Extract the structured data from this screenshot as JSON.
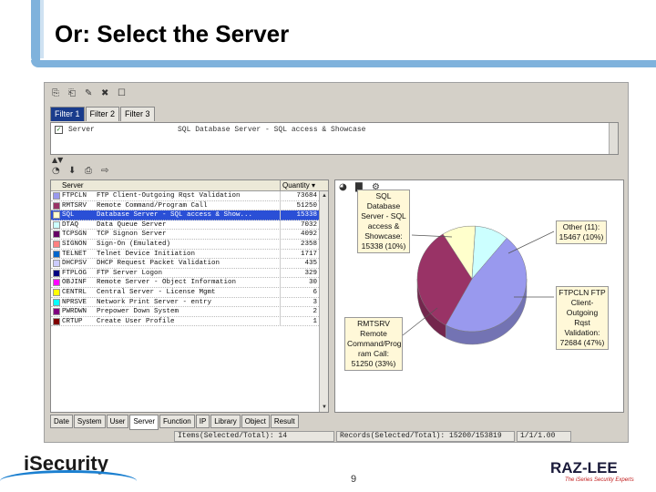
{
  "slide": {
    "title": "Or: Select the Server",
    "page_number": "9"
  },
  "logos": {
    "left": "iSecurity",
    "right": "RAZ-LEE",
    "right_tagline": "The iSeries Security Experts"
  },
  "top_tabs": [
    "Filter 1",
    "Filter 2",
    "Filter 3"
  ],
  "filter": {
    "field": "Server",
    "value": "SQL   Database Server - SQL access & Showcase",
    "checked": true
  },
  "grid": {
    "headers": {
      "server": "Server",
      "quantity": "Quantity"
    },
    "rows": [
      {
        "code": "FTPCLN",
        "desc": "FTP Client-Outgoing Rqst Validation",
        "qty": "73684",
        "color": "#9999ee",
        "selected": false
      },
      {
        "code": "RMTSRV",
        "desc": "Remote Command/Program Call",
        "qty": "51250",
        "color": "#993366",
        "selected": false
      },
      {
        "code": "SQL",
        "desc": "Database Server - SQL access & Show...",
        "qty": "15338",
        "color": "#ffffcc",
        "selected": true
      },
      {
        "code": "DTAQ",
        "desc": "Data Queue Server",
        "qty": "7032",
        "color": "#ccffff",
        "selected": false
      },
      {
        "code": "TCPSGN",
        "desc": "TCP Signon Server",
        "qty": "4092",
        "color": "#660066",
        "selected": false
      },
      {
        "code": "SIGNON",
        "desc": "Sign-On (Emulated)",
        "qty": "2358",
        "color": "#ff8080",
        "selected": false
      },
      {
        "code": "TELNET",
        "desc": "Telnet Device Initiation",
        "qty": "1717",
        "color": "#0066cc",
        "selected": false
      },
      {
        "code": "DHCPSV",
        "desc": "DHCP Request Packet Validation",
        "qty": "435",
        "color": "#ccccff",
        "selected": false
      },
      {
        "code": "FTPLOG",
        "desc": "FTP Server Logon",
        "qty": "329",
        "color": "#000080",
        "selected": false
      },
      {
        "code": "OBJINF",
        "desc": "Remote Server - Object Information",
        "qty": "30",
        "color": "#ff00ff",
        "selected": false
      },
      {
        "code": "CENTRL",
        "desc": "Central Server - License Mgmt",
        "qty": "6",
        "color": "#ffff00",
        "selected": false
      },
      {
        "code": "NPRSVE",
        "desc": "Network Print Server - entry",
        "qty": "3",
        "color": "#00ffff",
        "selected": false
      },
      {
        "code": "PWRDWN",
        "desc": "Prepower Down System",
        "qty": "2",
        "color": "#800080",
        "selected": false
      },
      {
        "code": "CRTUP",
        "desc": "Create User Profile",
        "qty": "1",
        "color": "#800000",
        "selected": false
      }
    ]
  },
  "chart_data": {
    "type": "pie",
    "title": "",
    "slices": [
      {
        "label": "FTPCLN FTP Client-Outgoing Rqst Validation",
        "value": 72684,
        "percent": 47,
        "color": "#9999ee"
      },
      {
        "label": "RMTSRV Remote Command/Program Call",
        "value": 51250,
        "percent": 33,
        "color": "#993366"
      },
      {
        "label": "SQL Database Server - SQL access & Showcase",
        "value": 15338,
        "percent": 10,
        "color": "#ffffcc"
      },
      {
        "label": "Other (11)",
        "value": 15467,
        "percent": 10,
        "color": "#ccffff"
      }
    ],
    "callouts": {
      "sql": [
        "SQL",
        "Database",
        "Server - SQL",
        "access &",
        "Showcase:",
        "15338 (10%)"
      ],
      "other": [
        "Other (11):",
        "15467 (10%)"
      ],
      "ftpcln": [
        "FTPCLN FTP",
        "Client-",
        "Outgoing Rqst",
        "Validation:",
        "72684 (47%)"
      ],
      "rmtsrv": [
        "RMTSRV",
        "Remote",
        "Command/Prog",
        "ram Call:",
        "51250 (33%)"
      ]
    }
  },
  "bottom_tabs": [
    "Date",
    "System",
    "User",
    "Server",
    "Function",
    "IP",
    "Library",
    "Object",
    "Result"
  ],
  "active_bottom_tab": "Server",
  "status": {
    "items": "Items(Selected/Total): 14",
    "records": "Records(Selected/Total): 15200/153819",
    "extra": "1/1/1.00"
  }
}
